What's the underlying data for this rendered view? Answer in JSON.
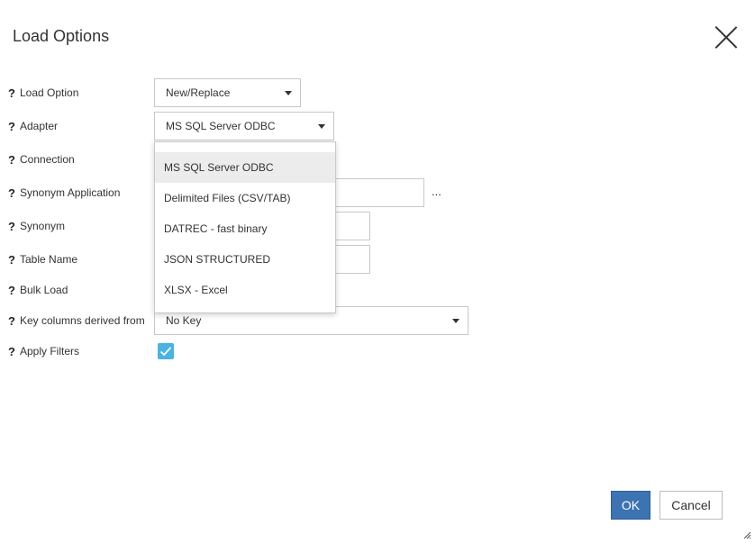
{
  "dialog": {
    "title": "Load Options",
    "close_label": ""
  },
  "form": {
    "load_option": {
      "label": "Load Option",
      "value": "New/Replace"
    },
    "adapter": {
      "label": "Adapter",
      "value": "MS SQL Server ODBC"
    },
    "connection": {
      "label": "Connection"
    },
    "synonym_application": {
      "label": "Synonym Application",
      "browse_label": "..."
    },
    "synonym": {
      "label": "Synonym"
    },
    "table_name": {
      "label": "Table Name"
    },
    "bulk_load": {
      "label": "Bulk Load"
    },
    "key_columns": {
      "label": "Key columns derived from",
      "value": "No Key"
    },
    "apply_filters": {
      "label": "Apply Filters",
      "checked": true
    }
  },
  "help_marker": "?",
  "adapter_dropdown": {
    "options": [
      {
        "label": "MS SQL Server ODBC",
        "selected": true
      },
      {
        "label": "Delimited Files (CSV/TAB)"
      },
      {
        "label": "DATREC - fast binary"
      },
      {
        "label": "JSON STRUCTURED"
      },
      {
        "label": "XLSX - Excel"
      }
    ]
  },
  "footer": {
    "ok_label": "OK",
    "cancel_label": "Cancel"
  },
  "colors": {
    "primary": "#3c73b2",
    "checkbox": "#49b3e4",
    "selected_option": "#ececec"
  }
}
